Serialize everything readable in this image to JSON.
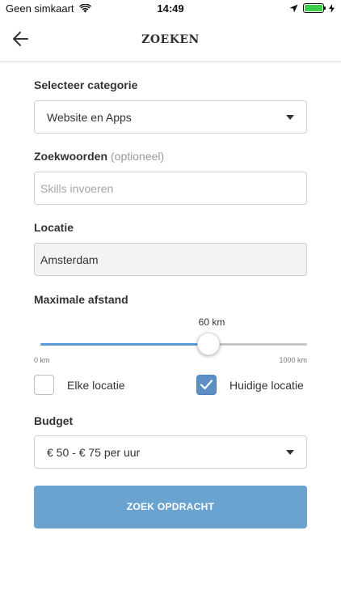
{
  "status_bar": {
    "carrier": "Geen simkaart",
    "time": "14:49",
    "wifi_icon": "wifi-icon",
    "location_icon": "location-arrow-icon",
    "battery_icon": "battery-icon",
    "charging_icon": "bolt-icon",
    "battery_level": 1.0
  },
  "nav": {
    "title": "ZOEKEN",
    "back_icon": "arrow-left-icon"
  },
  "category": {
    "label": "Selecteer categorie",
    "value": "Website en Apps"
  },
  "keywords": {
    "label": "Zoekwoorden",
    "optional": "(optioneel)",
    "placeholder": "Skills invoeren",
    "value": ""
  },
  "location": {
    "label": "Locatie",
    "value": "Amsterdam"
  },
  "distance": {
    "label": "Maximale afstand",
    "value_text": "60 km",
    "min_text": "0 km",
    "max_text": "1000 km",
    "position_fraction": 0.63
  },
  "location_options": {
    "any": {
      "label": "Elke locatie",
      "checked": false
    },
    "current": {
      "label": "Huidige locatie",
      "checked": true
    }
  },
  "budget": {
    "label": "Budget",
    "value": "€ 50 - € 75 per uur"
  },
  "submit_label": "ZOEK OPDRACHT",
  "colors": {
    "accent": "#5b8fc6",
    "button": "#6aa3cf",
    "slider_fill": "#5b9bd5"
  }
}
